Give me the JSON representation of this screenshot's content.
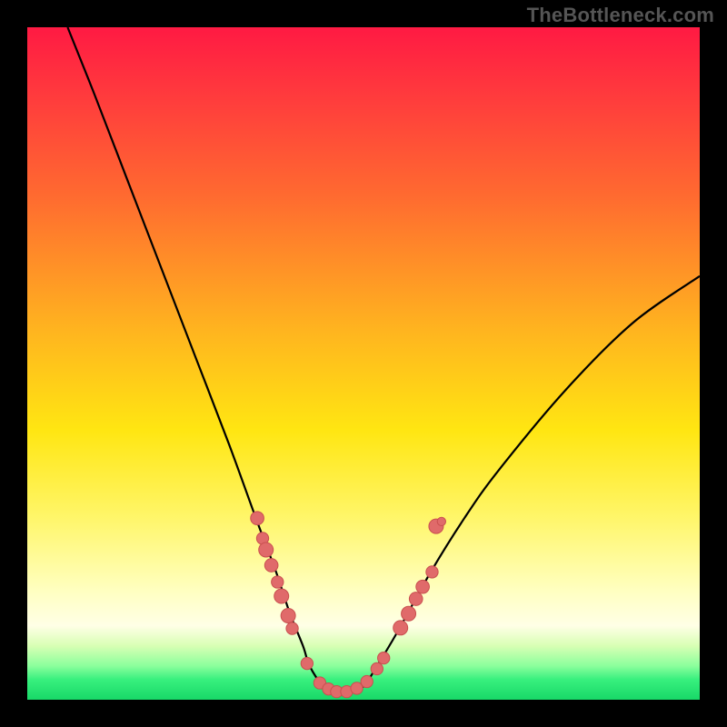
{
  "brand": "TheBottleneck.com",
  "colors": {
    "background": "#000000",
    "curve": "#000000",
    "marker_fill": "#e06a6a",
    "marker_stroke": "#c94f4f"
  },
  "chart_data": {
    "type": "line",
    "title": "",
    "xlabel": "",
    "ylabel": "",
    "xlim": [
      0,
      100
    ],
    "ylim": [
      0,
      100
    ],
    "grid": false,
    "legend": false,
    "series": [
      {
        "name": "bottleneck-curve",
        "x": [
          6,
          10,
          15,
          20,
          25,
          30,
          34,
          37,
          39,
          41,
          42,
          44,
          46,
          48,
          50,
          52,
          55,
          60,
          65,
          70,
          80,
          90,
          100
        ],
        "y": [
          100,
          90,
          77,
          64,
          51,
          38,
          27,
          19,
          13,
          8,
          5,
          2,
          1,
          1,
          2,
          5,
          10,
          19,
          27,
          34,
          46,
          56,
          63
        ]
      }
    ],
    "markers": [
      {
        "x": 34.2,
        "y": 27.0,
        "r": 1.1
      },
      {
        "x": 35.0,
        "y": 24.0,
        "r": 1.0
      },
      {
        "x": 35.5,
        "y": 22.3,
        "r": 1.2
      },
      {
        "x": 36.3,
        "y": 20.0,
        "r": 1.1
      },
      {
        "x": 37.2,
        "y": 17.5,
        "r": 1.0
      },
      {
        "x": 37.8,
        "y": 15.4,
        "r": 1.2
      },
      {
        "x": 38.8,
        "y": 12.5,
        "r": 1.2
      },
      {
        "x": 39.4,
        "y": 10.6,
        "r": 1.0
      },
      {
        "x": 41.6,
        "y": 5.4,
        "r": 1.0
      },
      {
        "x": 43.5,
        "y": 2.5,
        "r": 1.0
      },
      {
        "x": 44.8,
        "y": 1.6,
        "r": 1.0
      },
      {
        "x": 46.0,
        "y": 1.2,
        "r": 1.0
      },
      {
        "x": 47.5,
        "y": 1.2,
        "r": 1.0
      },
      {
        "x": 49.0,
        "y": 1.7,
        "r": 1.0
      },
      {
        "x": 50.5,
        "y": 2.7,
        "r": 1.0
      },
      {
        "x": 52.0,
        "y": 4.6,
        "r": 1.0
      },
      {
        "x": 53.0,
        "y": 6.2,
        "r": 1.0
      },
      {
        "x": 55.5,
        "y": 10.7,
        "r": 1.2
      },
      {
        "x": 56.7,
        "y": 12.8,
        "r": 1.2
      },
      {
        "x": 57.8,
        "y": 15.0,
        "r": 1.1
      },
      {
        "x": 58.8,
        "y": 16.8,
        "r": 1.1
      },
      {
        "x": 60.2,
        "y": 19.0,
        "r": 1.0
      },
      {
        "x": 60.8,
        "y": 25.8,
        "r": 1.2
      },
      {
        "x": 61.6,
        "y": 26.5,
        "r": 0.7
      }
    ]
  }
}
